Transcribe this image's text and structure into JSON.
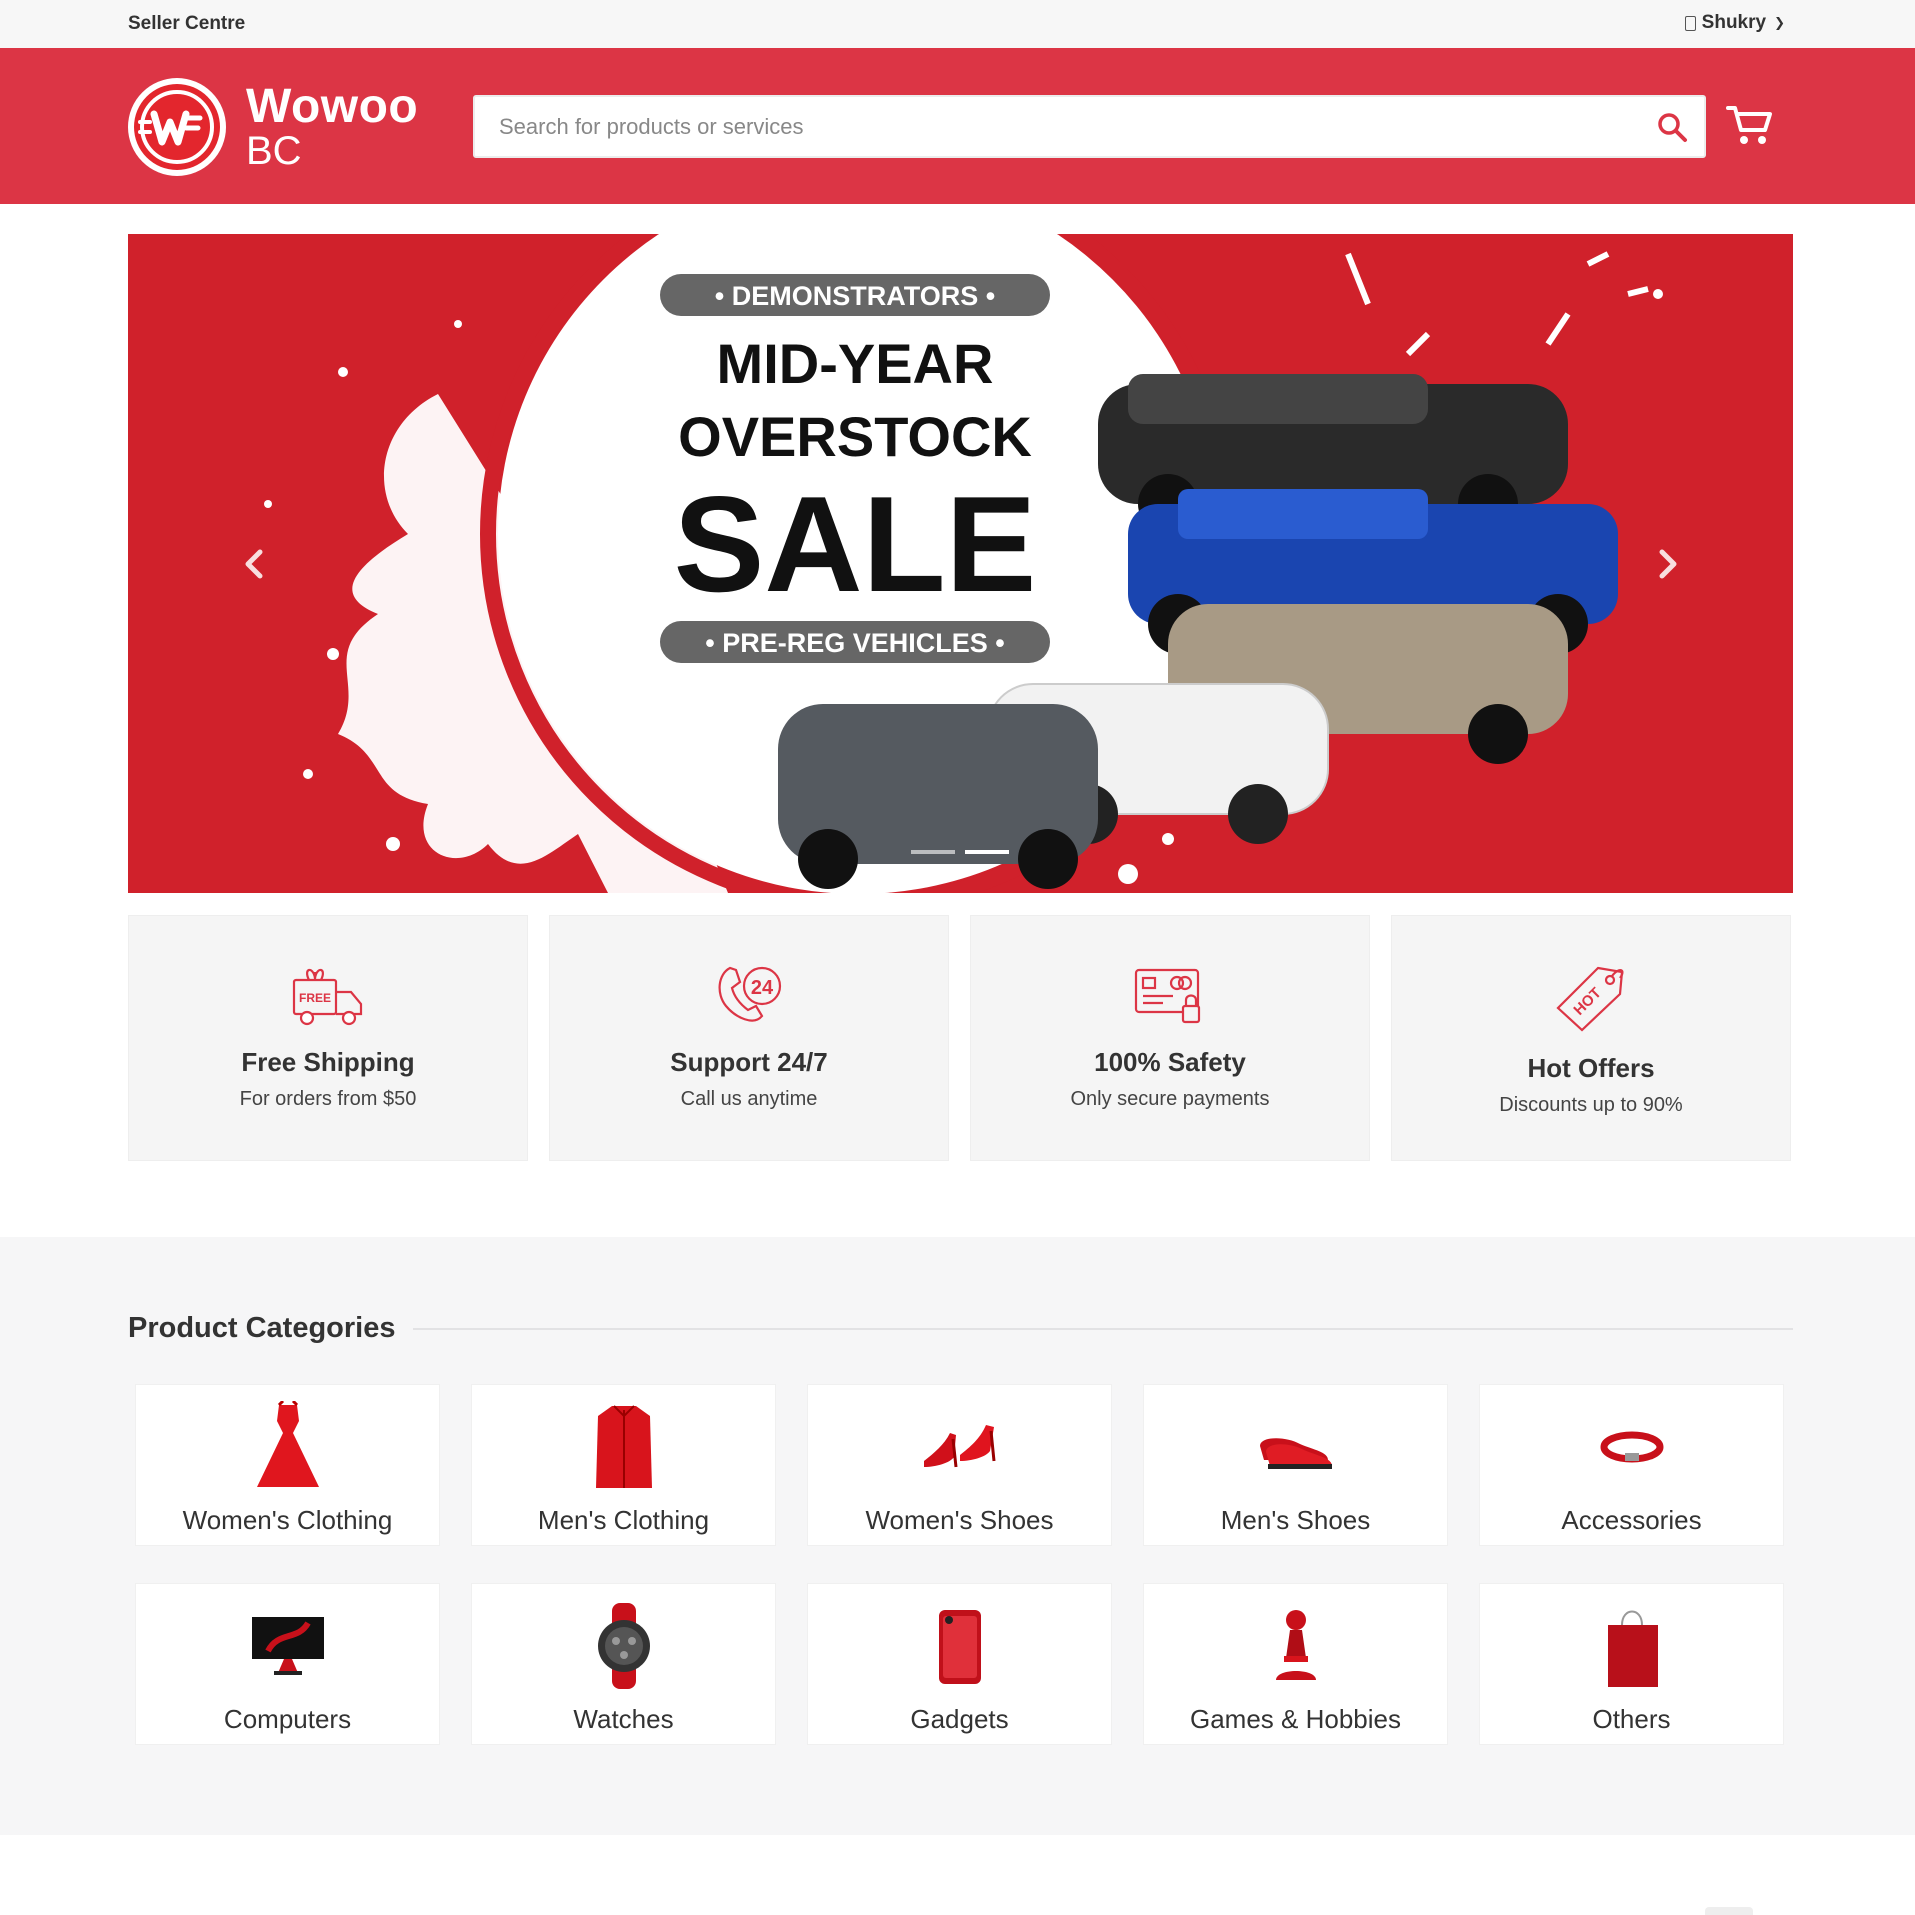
{
  "topbar": {
    "seller_centre": "Seller Centre",
    "user_name": "Shukry"
  },
  "header": {
    "brand_line1": "Wowoo",
    "brand_line2": "BC",
    "logo_mark": "W",
    "search_placeholder": "Search for products or services",
    "accent_color": "#dc3545"
  },
  "banner": {
    "top_pill": "• DEMONSTRATORS •",
    "line1": "MID-YEAR",
    "line2": "OVERSTOCK",
    "line3": "SALE",
    "bottom_pill": "• PRE-REG VEHICLES •",
    "prev_icon": "chevron-left-icon",
    "next_icon": "chevron-right-icon",
    "slide_count": 2,
    "active_slide": 2
  },
  "features": [
    {
      "icon": "free-shipping-truck-icon",
      "title": "Free Shipping",
      "subtitle": "For orders from $50",
      "badge": "FREE"
    },
    {
      "icon": "support-phone-24-icon",
      "title": "Support 24/7",
      "subtitle": "Call us anytime",
      "badge": "24"
    },
    {
      "icon": "secure-payment-icon",
      "title": "100% Safety",
      "subtitle": "Only secure payments"
    },
    {
      "icon": "hot-tag-icon",
      "title": "Hot Offers",
      "subtitle": "Discounts up to 90%",
      "badge": "HOT"
    }
  ],
  "categories": {
    "heading": "Product Categories",
    "items": [
      {
        "label": "Women's Clothing",
        "icon": "dress-icon"
      },
      {
        "label": "Men's Clothing",
        "icon": "shirt-icon"
      },
      {
        "label": "Women's Shoes",
        "icon": "heels-icon"
      },
      {
        "label": "Men's Shoes",
        "icon": "loafers-icon"
      },
      {
        "label": "Accessories",
        "icon": "bracelet-icon"
      },
      {
        "label": "Computers",
        "icon": "monitor-icon"
      },
      {
        "label": "Watches",
        "icon": "watch-icon"
      },
      {
        "label": "Gadgets",
        "icon": "phone-icon"
      },
      {
        "label": "Games & Hobbies",
        "icon": "chess-pawn-icon"
      },
      {
        "label": "Others",
        "icon": "shopping-bag-icon"
      }
    ]
  }
}
